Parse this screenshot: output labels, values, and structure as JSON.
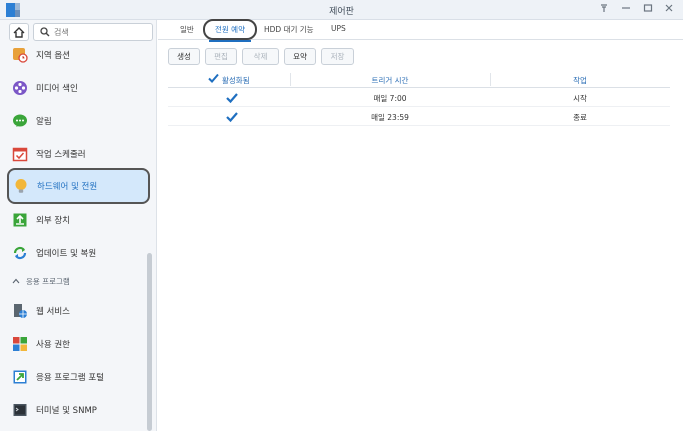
{
  "window": {
    "title": "제어판"
  },
  "sidebar": {
    "search_placeholder": "검색",
    "items_top": [
      {
        "label": "지역 옵션",
        "icon": "region-options-icon"
      },
      {
        "label": "미디어 색인",
        "icon": "media-index-icon"
      },
      {
        "label": "알림",
        "icon": "notification-icon"
      },
      {
        "label": "작업 스케줄러",
        "icon": "task-scheduler-icon"
      },
      {
        "label": "하드웨어 및 전원",
        "icon": "hardware-power-icon",
        "active": true
      },
      {
        "label": "외부 장치",
        "icon": "external-devices-icon"
      },
      {
        "label": "업데이트 및 복원",
        "icon": "update-restore-icon"
      }
    ],
    "section_label": "응용 프로그램",
    "items_bottom": [
      {
        "label": "웹 서비스",
        "icon": "web-services-icon"
      },
      {
        "label": "사용 권한",
        "icon": "privileges-icon"
      },
      {
        "label": "응용 프로그램 포털",
        "icon": "application-portal-icon"
      },
      {
        "label": "터미널 및 SNMP",
        "icon": "terminal-snmp-icon"
      }
    ]
  },
  "tabs": [
    {
      "label": "일반"
    },
    {
      "label": "전원 예약",
      "active": true
    },
    {
      "label": "HDD 대기 기능"
    },
    {
      "label": "UPS"
    }
  ],
  "toolbar": {
    "create": "생성",
    "edit": "편집",
    "delete": "삭제",
    "summary": "요약",
    "save": "저장"
  },
  "grid": {
    "headers": {
      "enabled": "활성화됨",
      "trigger_time": "트리거 시간",
      "action": "작업"
    },
    "rows": [
      {
        "enabled": true,
        "trigger_time": "매일 7:00",
        "action": "시작"
      },
      {
        "enabled": true,
        "trigger_time": "매일 23:59",
        "action": "종료"
      }
    ]
  },
  "colors": {
    "accent": "#1f6fc0",
    "active_bg": "#d4e8fb",
    "check": "#1f6fc0"
  }
}
